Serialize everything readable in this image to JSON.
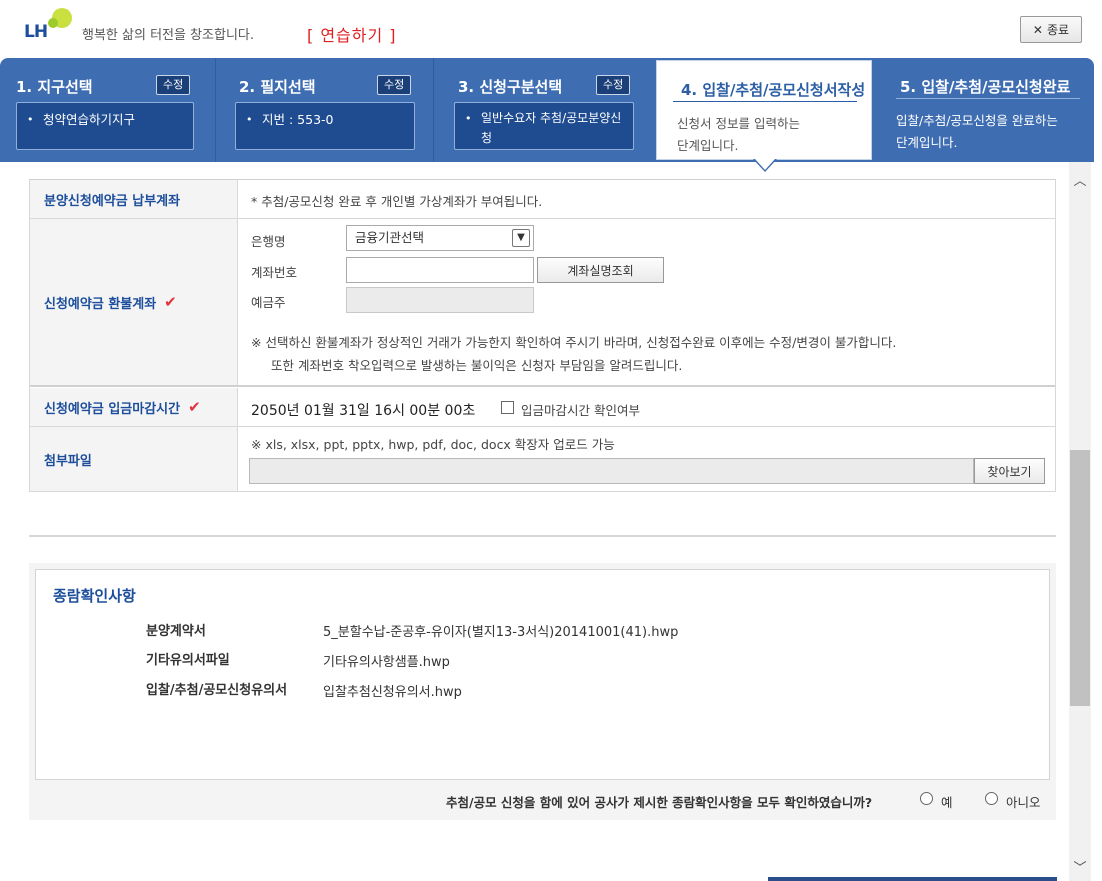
{
  "header": {
    "logo_text": "LH",
    "slogan": "행복한 삶의 터전을 창조합니다.",
    "mode_label": "[ 연습하기 ]",
    "close_label": "종료"
  },
  "steps": [
    {
      "title": "1. 지구선택",
      "edit": "수정",
      "value": "청약연습하기지구"
    },
    {
      "title": "2. 필지선택",
      "edit": "수정",
      "value": "지번 : 553-0"
    },
    {
      "title": "3. 신청구분선택",
      "edit": "수정",
      "value_line1": "일반수요자 추첨/공모분양신",
      "value_line2": "청"
    },
    {
      "title": "4. 입찰/추첨/공모신청서작성",
      "desc_line1": "신청서 정보를 입력하는",
      "desc_line2": "단계입니다."
    },
    {
      "title": "5. 입찰/추첨/공모신청완료",
      "desc_line1": "입찰/추첨/공모신청을 완료하는",
      "desc_line2": "단계입니다."
    }
  ],
  "form": {
    "deposit_label": "분양신청예약금 납부계좌",
    "deposit_note": "* 추첨/공모신청 완료 후 개인별 가상계좌가 부여됩니다.",
    "refund_label": "신청예약금 환불계좌",
    "bank_label": "은행명",
    "bank_value": "금융기관선택",
    "account_label": "계좌번호",
    "account_value": "",
    "verify_button": "계좌실명조회",
    "holder_label": "예금주",
    "holder_value": "",
    "refund_note1": "※ 선택하신 환불계좌가 정상적인 거래가 가능한지 확인하여 주시기 바라며, 신청접수완료 이후에는 수정/변경이 불가합니다.",
    "refund_note2": "또한 계좌번호 착오입력으로 발생하는 불이익은 신청자 부담임을 알려드립니다.",
    "deadline_label": "신청예약금 입금마감시간",
    "deadline_value": "2050년 01월 31일 16시 00분 00초",
    "deadline_check": "입금마감시간 확인여부",
    "attach_label": "첨부파일",
    "attach_note": "※ xls, xlsx, ppt, pptx, hwp, pdf, doc, docx 확장자 업로드 가능",
    "browse_button": "찾아보기"
  },
  "confirm": {
    "heading": "종람확인사항",
    "items": [
      {
        "label": "분양계약서",
        "file": "5_분할수납-준공후-유이자(별지13-3서식)20141001(41).hwp"
      },
      {
        "label": "기타유의서파일",
        "file": "기타유의사항샘플.hwp"
      },
      {
        "label": "입찰/추첨/공모신청유의서",
        "file": "입찰추첨신청유의서.hwp"
      }
    ],
    "question": "추첨/공모 신청을 함에 있어 공사가 제시한 종람확인사항을 모두 확인하였습니까?",
    "yes": "예",
    "no": "아니오"
  },
  "colors": {
    "primary": "#3f6db2",
    "accent_red": "#e0353d",
    "label_blue": "#1d4e9c"
  }
}
